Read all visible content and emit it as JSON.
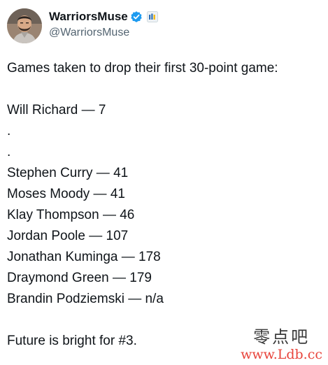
{
  "author": {
    "display_name": "WarriorsMuse",
    "handle": "@WarriorsMuse",
    "avatar_icon": "user-avatar",
    "verified_color": "#1d9bf0"
  },
  "tweet": {
    "intro": "Games taken to drop their first 30-point game:",
    "highlight": "Will Richard — 7",
    "separators": [
      ".",
      "."
    ],
    "list": [
      "Stephen Curry — 41",
      "Moses Moody — 41",
      "Klay Thompson — 46",
      "Jordan Poole — 107",
      "Jonathan Kuminga — 178",
      "Draymond Green — 179",
      "Brandin Podziemski — n/a"
    ],
    "closing": "Future is bright for #3."
  },
  "watermark": {
    "chinese": "零点吧",
    "url": "www.Ldb.cc"
  }
}
